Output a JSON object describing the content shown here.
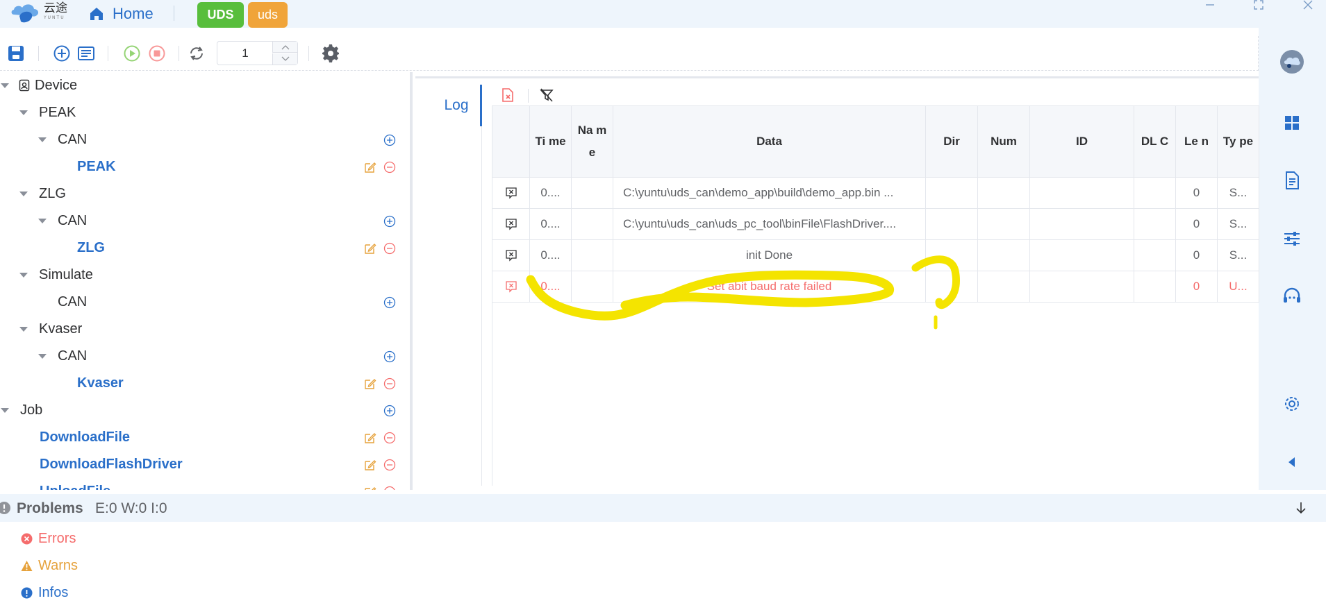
{
  "titlebar": {
    "logo_text": "云途",
    "logo_sub": "YUNTU",
    "home_label": "Home",
    "tag_uds": "UDS",
    "tag_uds_lower": "uds"
  },
  "toolbar": {
    "counter_value": "1"
  },
  "tree": {
    "device": "Device",
    "peak": "PEAK",
    "peak_can": "CAN",
    "peak_item": "PEAK",
    "zlg": "ZLG",
    "zlg_can": "CAN",
    "zlg_item": "ZLG",
    "simulate": "Simulate",
    "simulate_can": "CAN",
    "kvaser": "Kvaser",
    "kvaser_can": "CAN",
    "kvaser_item": "Kvaser",
    "job": "Job",
    "download_file": "DownloadFile",
    "download_flash": "DownloadFlashDriver",
    "upload_file": "UploadFile"
  },
  "log": {
    "tab": "Log",
    "columns": [
      "Ti me",
      "Na me",
      "Data",
      "Dir",
      "Num",
      "ID",
      "DL C",
      "Le n",
      "Ty pe"
    ],
    "rows": [
      {
        "time": "0....",
        "name": "",
        "data": "C:\\yuntu\\uds_can\\demo_app\\build\\demo_app.bin ...",
        "dir": "",
        "num": "",
        "id": "",
        "dlc": "",
        "len": "0",
        "type": "S...",
        "error": false
      },
      {
        "time": "0....",
        "name": "",
        "data": "C:\\yuntu\\uds_can\\uds_pc_tool\\binFile\\FlashDriver....",
        "dir": "",
        "num": "",
        "id": "",
        "dlc": "",
        "len": "0",
        "type": "S...",
        "error": false
      },
      {
        "time": "0....",
        "name": "",
        "data": "init Done",
        "dir": "",
        "num": "",
        "id": "",
        "dlc": "",
        "len": "0",
        "type": "S...",
        "error": false
      },
      {
        "time": "0....",
        "name": "",
        "data": "Set abit baud rate failed",
        "dir": "",
        "num": "",
        "id": "",
        "dlc": "",
        "len": "0",
        "type": "U...",
        "error": true
      }
    ]
  },
  "problems": {
    "title": "Problems",
    "counts": "E:0 W:0 I:0",
    "errors": "Errors",
    "warns": "Warns",
    "infos": "Infos"
  },
  "colors": {
    "primary": "#2a6fc9",
    "uds_tag": "#58be3c",
    "uds_lower_tag": "#f0a43a",
    "error": "#f56c6c",
    "warn": "#e6a23c",
    "highlight_scribble": "#f4e400"
  }
}
